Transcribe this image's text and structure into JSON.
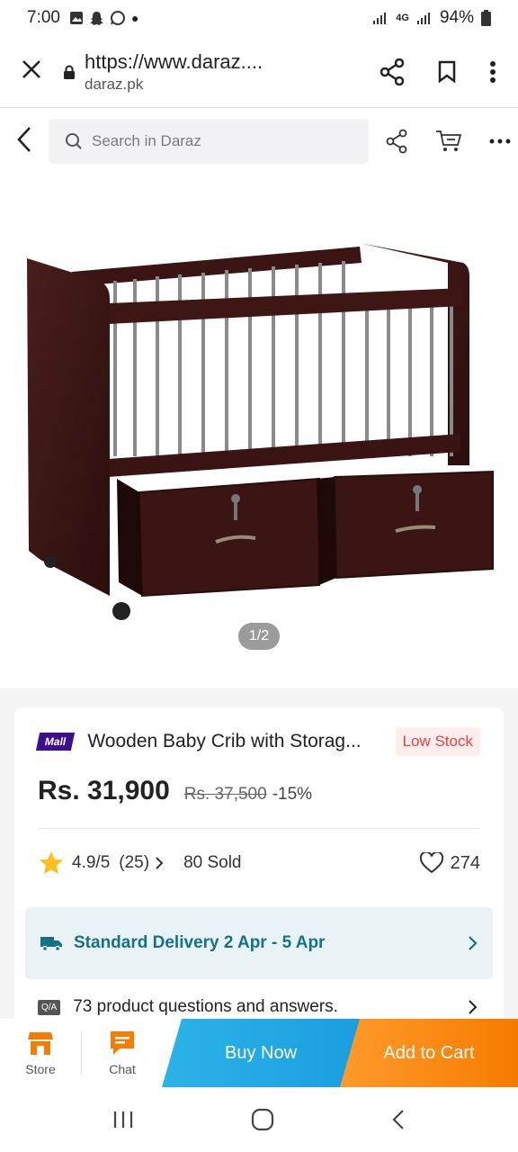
{
  "status_bar": {
    "time": "7:00",
    "network": "4G",
    "battery": "94%"
  },
  "browser": {
    "url": "https://www.daraz....",
    "domain": "daraz.pk"
  },
  "search": {
    "placeholder": "Search in Daraz"
  },
  "gallery": {
    "counter": "1/2"
  },
  "product": {
    "badge": "Mall",
    "title": "Wooden Baby Crib with Storag...",
    "stock": "Low Stock",
    "price": "Rs. 31,900",
    "original_price": "Rs. 37,500",
    "discount": "-15%",
    "rating": "4.9/5",
    "reviews": "(25)",
    "sold": "80 Sold",
    "likes": "274"
  },
  "delivery": {
    "text": "Standard Delivery 2 Apr - 5 Apr"
  },
  "qa": {
    "badge": "Q/A",
    "text": "73 product questions and answers."
  },
  "bottom_bar": {
    "store": "Store",
    "chat": "Chat",
    "buy_now": "Buy Now",
    "add_to_cart": "Add to Cart"
  },
  "colors": {
    "accent_orange": "#f57c00",
    "accent_blue": "#1a9ee0",
    "mall_purple": "#3d0f8f",
    "delivery_teal": "#147285",
    "low_stock_red": "#e84040",
    "star_yellow": "#fcbf1e"
  }
}
